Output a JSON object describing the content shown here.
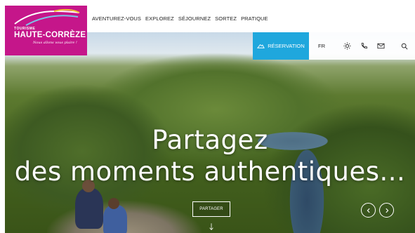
{
  "logo": {
    "tourisme": "TOURISME",
    "name": "HAUTE-CORRÈZE",
    "tagline": "Nous allons vous plaire !"
  },
  "nav": {
    "items": [
      {
        "label": "AVENTUREZ-VOUS"
      },
      {
        "label": "EXPLOREZ"
      },
      {
        "label": "SÉJOURNEZ"
      },
      {
        "label": "SORTEZ"
      },
      {
        "label": "PRATIQUE"
      }
    ]
  },
  "topbar": {
    "reservation_label": "RÉSERVATION",
    "lang": "FR",
    "icons": [
      "weather-sun-icon",
      "phone-icon",
      "mail-icon",
      "search-icon"
    ]
  },
  "hero": {
    "headline_line1": "Partagez",
    "headline_line2": "des moments authentiques...",
    "share_label": "PARTAGER"
  },
  "colors": {
    "brand_magenta": "#c5168a",
    "reservation_blue": "#1fa7dd"
  }
}
